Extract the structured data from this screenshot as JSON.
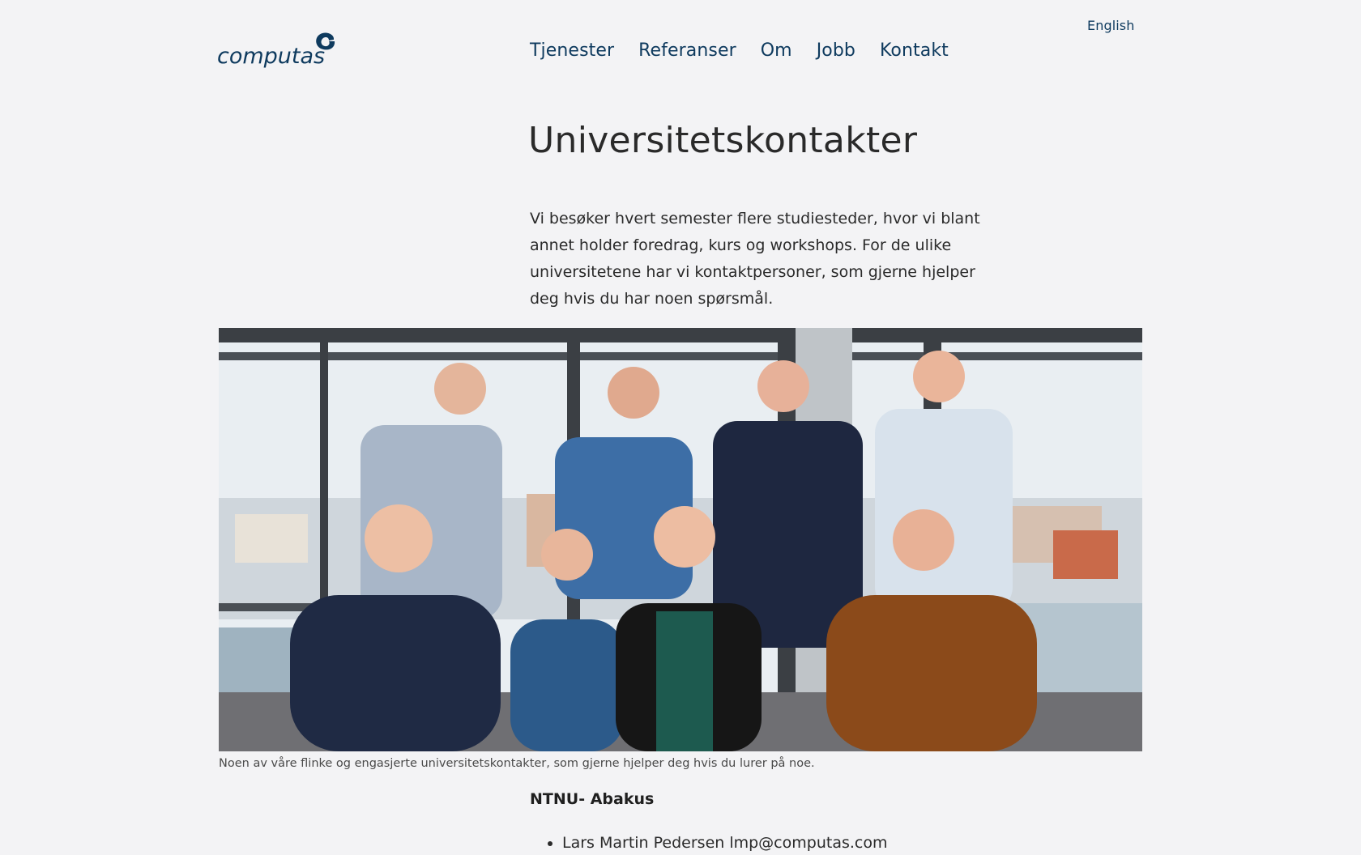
{
  "header": {
    "language_link": "English",
    "logo_text": "computas",
    "nav": [
      {
        "label": "Tjenester"
      },
      {
        "label": "Referanser"
      },
      {
        "label": "Om"
      },
      {
        "label": "Jobb"
      },
      {
        "label": "Kontakt"
      }
    ]
  },
  "main": {
    "title": "Universitetskontakter",
    "intro": "Vi besøker hvert semester flere studiesteder, hvor vi blant annet holder foredrag, kurs og workshops. For de ulike universitetene har vi kontaktpersoner, som gjerne hjelper deg hvis du har noen spørsmål.",
    "photo_caption": "Noen av våre flinke og engasjerte universitetskontakter, som gjerne hjelper deg hvis du lurer på noe.",
    "sections": [
      {
        "heading": "NTNU- Abakus",
        "contacts": [
          {
            "text": "Lars Martin Pedersen lmp@computas.com"
          }
        ]
      }
    ]
  },
  "colors": {
    "brand_navy": "#0e3a5e",
    "background": "#f3f3f5"
  }
}
